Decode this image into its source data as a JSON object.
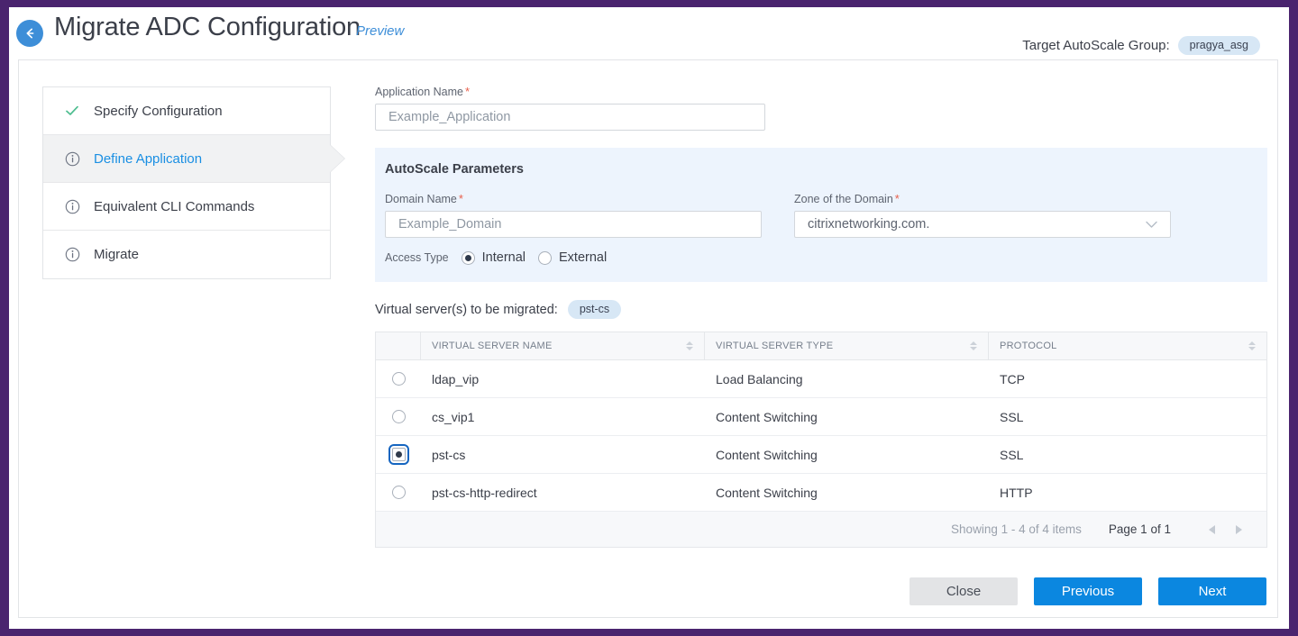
{
  "header": {
    "back_icon": "arrow-left-circle-icon",
    "title": "Migrate ADC Configuration",
    "preview_label": "Preview",
    "target_group_label": "Target AutoScale Group:",
    "target_group_value": "pragya_asg"
  },
  "steps": [
    {
      "label": "Specify Configuration",
      "icon": "check-icon",
      "state": "done"
    },
    {
      "label": "Define Application",
      "icon": "info-icon",
      "state": "active"
    },
    {
      "label": "Equivalent CLI Commands",
      "icon": "info-icon",
      "state": "todo"
    },
    {
      "label": "Migrate",
      "icon": "info-icon",
      "state": "todo"
    }
  ],
  "form": {
    "app_name_label": "Application Name",
    "app_name_value": "Example_Application",
    "app_name_placeholder": "Example_Application",
    "required_mark": "*",
    "autoscale": {
      "title": "AutoScale Parameters",
      "domain_name_label": "Domain Name",
      "domain_name_value": "Example_Domain",
      "domain_name_placeholder": "Example_Domain",
      "zone_label": "Zone of the Domain",
      "zone_value": "citrixnetworking.com.",
      "zone_chevron": "chevron-down-icon",
      "access_type_label": "Access Type",
      "access_options": [
        {
          "label": "Internal",
          "selected": true
        },
        {
          "label": "External",
          "selected": false
        }
      ]
    }
  },
  "virtual_servers": {
    "label": "Virtual server(s) to be migrated:",
    "selected_chip": "pst-cs",
    "columns": [
      "",
      "VIRTUAL SERVER NAME",
      "VIRTUAL SERVER TYPE",
      "PROTOCOL"
    ],
    "rows": [
      {
        "selected": false,
        "name": "ldap_vip",
        "type": "Load Balancing",
        "protocol": "TCP"
      },
      {
        "selected": false,
        "name": "cs_vip1",
        "type": "Content Switching",
        "protocol": "SSL"
      },
      {
        "selected": true,
        "name": "pst-cs",
        "type": "Content Switching",
        "protocol": "SSL"
      },
      {
        "selected": false,
        "name": "pst-cs-http-redirect",
        "type": "Content Switching",
        "protocol": "HTTP"
      }
    ],
    "footer": {
      "showing": "Showing 1 - 4 of 4 items",
      "page_prefix": "Page",
      "page_current": "1",
      "page_of": "of",
      "page_total": "1",
      "prev_icon": "chevron-left-icon",
      "next_icon": "chevron-right-icon"
    }
  },
  "actions": {
    "close": "Close",
    "previous": "Previous",
    "next": "Next"
  },
  "colors": {
    "frame_purple": "#4a246e",
    "accent_blue": "#0b87e0",
    "link_blue": "#1a8fe3",
    "panel_blue": "#edf4fd",
    "required_red": "#e8604c",
    "check_green": "#4dbd8f",
    "chip_blue": "#d7e7f5"
  }
}
